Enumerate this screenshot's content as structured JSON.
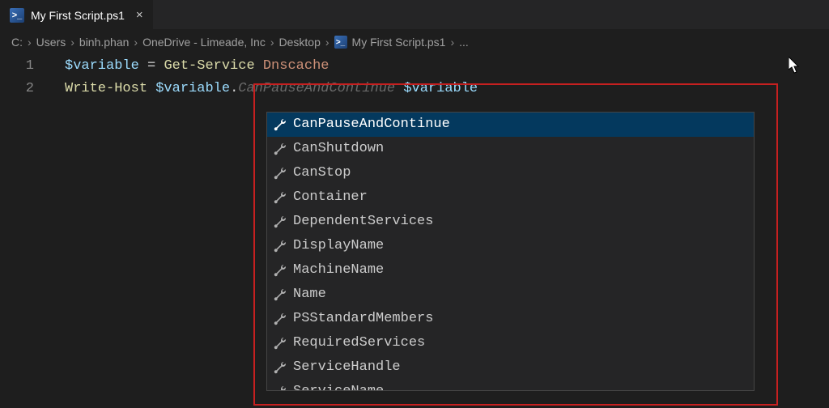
{
  "tab": {
    "filename": "My First Script.ps1"
  },
  "breadcrumb": {
    "items": [
      "C:",
      "Users",
      "binh.phan",
      "OneDrive - Limeade, Inc",
      "Desktop"
    ],
    "file": "My First Script.ps1",
    "tail": "..."
  },
  "code": {
    "lines": [
      {
        "num": "1",
        "variable": "$variable",
        "op": " = ",
        "cmd": "Get-Service",
        "sp": " ",
        "arg": "Dnscache"
      },
      {
        "num": "2",
        "cmd": "Write-Host",
        "sp": " ",
        "variable": "$variable",
        "dot": ".",
        "ghost": "CanPauseAndContinue",
        "sp2": " ",
        "variable2": "$variable"
      }
    ]
  },
  "intellisense": {
    "items": [
      {
        "label": "CanPauseAndContinue",
        "selected": true
      },
      {
        "label": "CanShutdown"
      },
      {
        "label": "CanStop"
      },
      {
        "label": "Container"
      },
      {
        "label": "DependentServices"
      },
      {
        "label": "DisplayName"
      },
      {
        "label": "MachineName"
      },
      {
        "label": "Name"
      },
      {
        "label": "PSStandardMembers"
      },
      {
        "label": "RequiredServices"
      },
      {
        "label": "ServiceHandle"
      },
      {
        "label": "ServiceName"
      }
    ]
  }
}
